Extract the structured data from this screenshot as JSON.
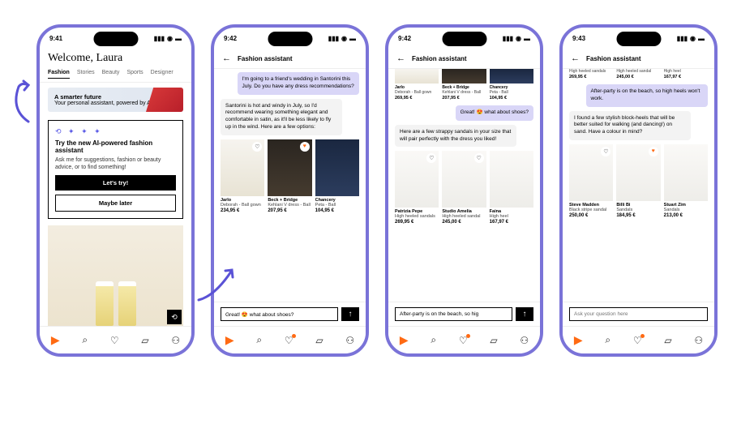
{
  "status": {
    "time1": "9:41",
    "time2": "9:42",
    "time3": "9:42",
    "time4": "9:43"
  },
  "phone1": {
    "welcome": "Welcome, Laura",
    "tabs": [
      "Fashion",
      "Stories",
      "Beauty",
      "Sports",
      "Designer"
    ],
    "banner": {
      "title": "A smarter future",
      "body": "Your personal assistant, powered by AI."
    },
    "card": {
      "heading": "Try the new AI-powered fashion assistant",
      "body": "Ask me for suggestions, fashion or beauty advice, or to find something!",
      "primary": "Let's try!",
      "secondary": "Maybe later"
    }
  },
  "phone2": {
    "header": "Fashion assistant",
    "user_msg": "I'm going to a friend's wedding in Santorini this July. Do you have any dress recommendations?",
    "ai_msg": "Santorini is hot and windy in July, so I'd recommend wearing something elegant and comfortable in satin, as it'll be less likely to fly up in the wind. Here are a few options:",
    "products": [
      {
        "brand": "Jarlo",
        "name": "Deborah - Ball gown",
        "price": "234,95 €",
        "fav": false
      },
      {
        "brand": "Beck + Bridge",
        "name": "Kehlani V dress - Ball",
        "price": "207,95 €",
        "fav": true
      },
      {
        "brand": "Chancery",
        "name": "Peta - Ball",
        "price": "104,95 €",
        "fav": false
      }
    ],
    "input": "Great! 😍 what about shoes?"
  },
  "phone3": {
    "header": "Fashion assistant",
    "top": [
      {
        "brand": "Jarlo",
        "name": "Deborah - Ball gown",
        "price": "269,95 €"
      },
      {
        "brand": "Beck + Bridge",
        "name": "Kehlani V dress - Ball",
        "price": "207,95 €"
      },
      {
        "brand": "Chancery",
        "name": "Peta - Ball",
        "price": "104,95 €"
      }
    ],
    "user_msg": "Great! 😍 what about shoes?",
    "ai_msg": "Here are a few strappy sandals in your size that will pair perfectly with the dress you liked!",
    "products": [
      {
        "brand": "Patrizia Pepe",
        "name": "High heeled sandals",
        "price": "269,95 €",
        "fav": false
      },
      {
        "brand": "Studio Amelia",
        "name": "High heeled sandal",
        "price": "245,00 €",
        "fav": false
      },
      {
        "brand": "Faina",
        "name": "High heel",
        "price": "167,97 €",
        "fav": false
      }
    ],
    "input": "After-party is on the beach, so hig"
  },
  "phone4": {
    "header": "Fashion assistant",
    "top": [
      {
        "brand": "",
        "name": "High heeled sandals",
        "price": "269,95 €"
      },
      {
        "brand": "",
        "name": "High heeled sandal",
        "price": "245,00 €"
      },
      {
        "brand": "",
        "name": "High heel",
        "price": "167,97 €"
      }
    ],
    "user_msg": "After-party is on the beach, so high heels won't work.",
    "ai_msg": "I found a few stylish block-heels that will be better suited for walking (and dancing!) on sand. Have a colour in mind?",
    "products": [
      {
        "brand": "Steve Madden",
        "name": "Black stripe sandal",
        "price": "250,00 €",
        "fav": false
      },
      {
        "brand": "Billi Bi",
        "name": "Sandals",
        "price": "184,95 €",
        "fav": true
      },
      {
        "brand": "Stuart Zim",
        "name": "Sandals",
        "price": "213,00 €",
        "fav": false
      }
    ],
    "placeholder": "Ask your question here"
  }
}
